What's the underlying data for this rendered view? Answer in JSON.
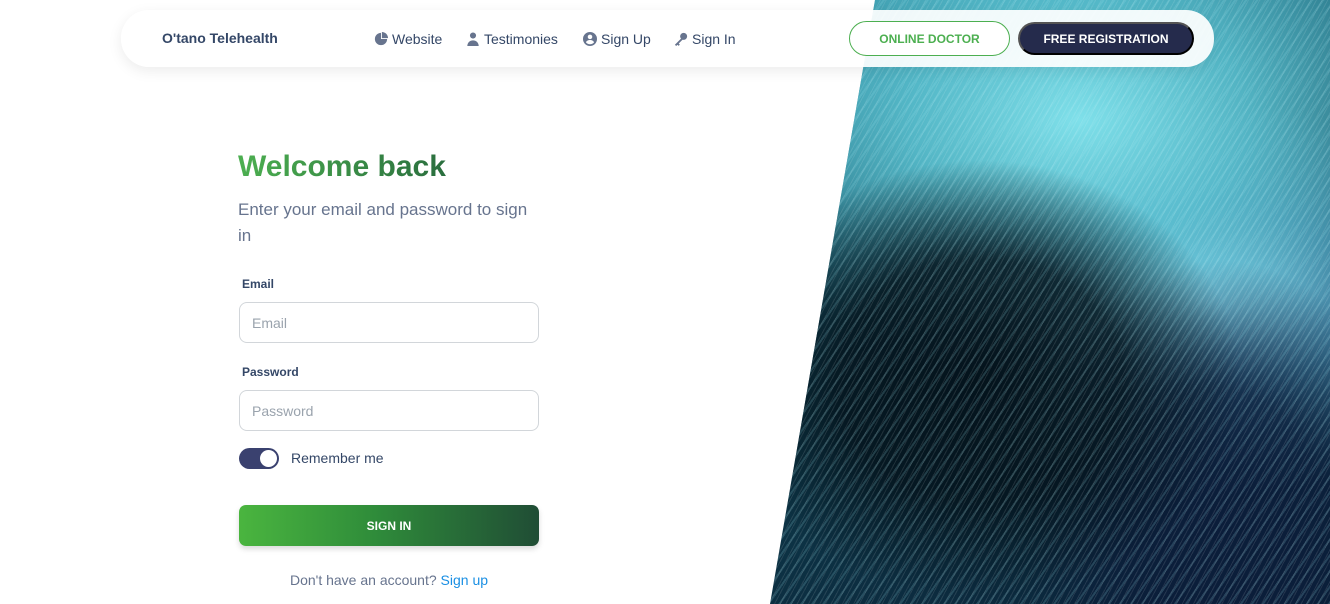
{
  "navbar": {
    "brand": "O'tano Telehealth",
    "links": [
      {
        "label": "Website",
        "icon": "pie-chart-icon"
      },
      {
        "label": "Testimonies",
        "icon": "user-icon"
      },
      {
        "label": "Sign Up",
        "icon": "user-circle-icon"
      },
      {
        "label": "Sign In",
        "icon": "key-icon"
      }
    ],
    "online_doctor_label": "ONLINE DOCTOR",
    "free_registration_label": "FREE REGISTRATION"
  },
  "form": {
    "title": "Welcome back",
    "subtitle": "Enter your email and password to sign in",
    "email_label": "Email",
    "email_placeholder": "Email",
    "email_value": "",
    "password_label": "Password",
    "password_placeholder": "Password",
    "password_value": "",
    "remember_label": "Remember me",
    "remember_checked": true,
    "submit_label": "SIGN IN",
    "signup_prompt": "Don't have an account?",
    "signup_link": "Sign up"
  },
  "colors": {
    "brand_green": "#4caf50",
    "dark_navy": "#252b4c",
    "link_blue": "#1a8fe3"
  }
}
